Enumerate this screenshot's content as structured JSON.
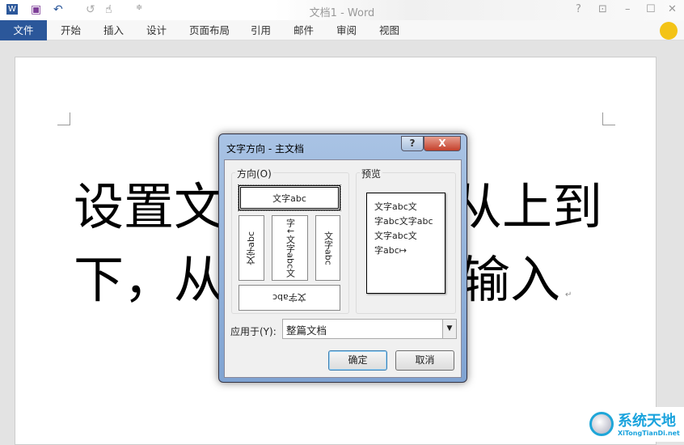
{
  "window": {
    "title": "文档1 - Word",
    "help": "?",
    "minimize": "–",
    "maximize": "☐",
    "close": "✕"
  },
  "quick_access": {
    "save_icon": "save-icon",
    "undo": "↶",
    "redo": "↺",
    "touch": "☝"
  },
  "ribbon": {
    "tabs": [
      "文件",
      "开始",
      "插入",
      "设计",
      "页面布局",
      "引用",
      "邮件",
      "审阅",
      "视图"
    ]
  },
  "document": {
    "line1_left": "设置文",
    "line1_right": "从上到",
    "line2_left": "下，从",
    "line2_right": "输入",
    "para_mark": "↵"
  },
  "dialog": {
    "title": "文字方向 - 主文档",
    "help": "?",
    "close": "X",
    "orientation_label": "方向(O)",
    "options": [
      "文字abc",
      "文字abc",
      "字↓文字abc文",
      "文字abc",
      "文字abc"
    ],
    "preview_label": "预览",
    "preview_lines": [
      "文字abc文",
      "字abc文字abc",
      "文字abc文",
      "字abc↦"
    ],
    "apply_label": "应用于(Y):",
    "apply_value": "整篇文档",
    "ok": "确定",
    "cancel": "取消"
  },
  "watermark": {
    "text": "系统天地",
    "url_text": "XiTongTianDi.net"
  }
}
